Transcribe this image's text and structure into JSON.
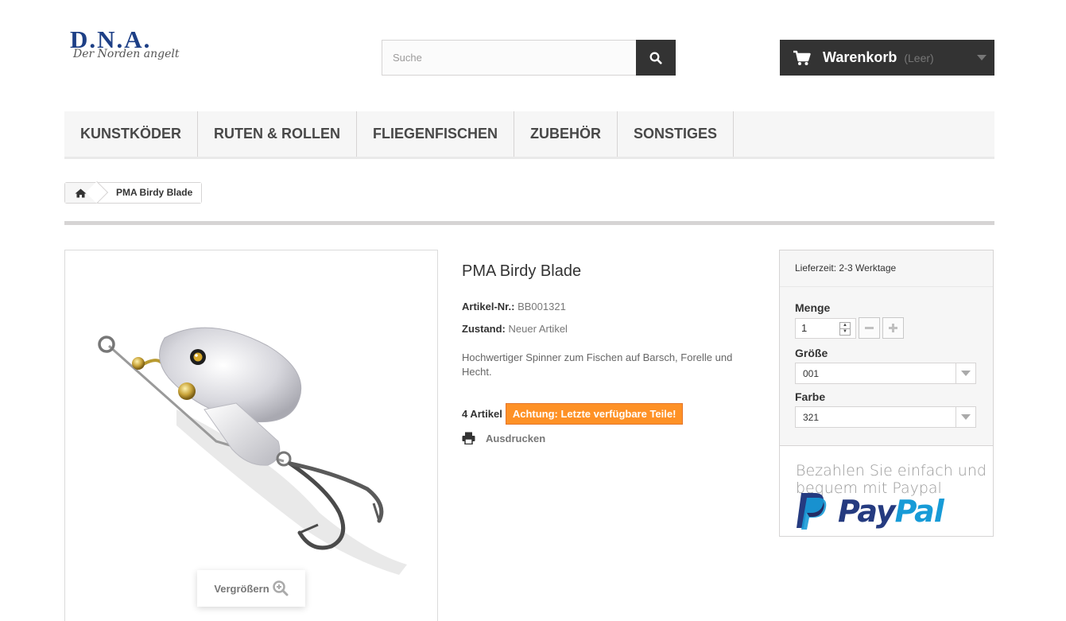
{
  "brand": {
    "logo_text": "D.N.A.",
    "logo_tagline": "Der Norden angelt"
  },
  "search": {
    "placeholder": "Suche",
    "icon": "search-icon"
  },
  "cart": {
    "label": "Warenkorb",
    "status": "(Leer)",
    "icon": "cart-icon"
  },
  "nav": {
    "items": [
      {
        "label": "KUNSTKÖDER"
      },
      {
        "label": "RUTEN & ROLLEN"
      },
      {
        "label": "FLIEGENFISCHEN"
      },
      {
        "label": "ZUBEHÖR"
      },
      {
        "label": "SONSTIGES"
      }
    ]
  },
  "breadcrumb": {
    "home_icon": "home-icon",
    "current": "PMA Birdy Blade"
  },
  "product": {
    "title": "PMA Birdy Blade",
    "article_label": "Artikel-Nr.:",
    "article_value": "BB001321",
    "condition_label": "Zustand:",
    "condition_value": "Neuer Artikel",
    "description": "Hochwertiger Spinner zum Fischen auf Barsch, Forelle und Hecht.",
    "stock_qty": "4 Artikel",
    "stock_warning": "Achtung: Letzte verfügbare Teile!",
    "print_label": "Ausdrucken",
    "zoom_label": "Vergrößern"
  },
  "buybox": {
    "delivery": "Lieferzeit: 2-3 Werktage",
    "quantity_label": "Menge",
    "quantity_value": "1",
    "size_label": "Größe",
    "size_value": "001",
    "color_label": "Farbe",
    "color_value": "321",
    "paypal_text": "Bezahlen Sie einfach und bequem mit Paypal",
    "paypal_pay": "Pay",
    "paypal_pal": "Pal"
  },
  "colors": {
    "dark": "#333333",
    "warning": "#fe9126",
    "paypal_dark": "#253b80",
    "paypal_light": "#179bd7"
  }
}
